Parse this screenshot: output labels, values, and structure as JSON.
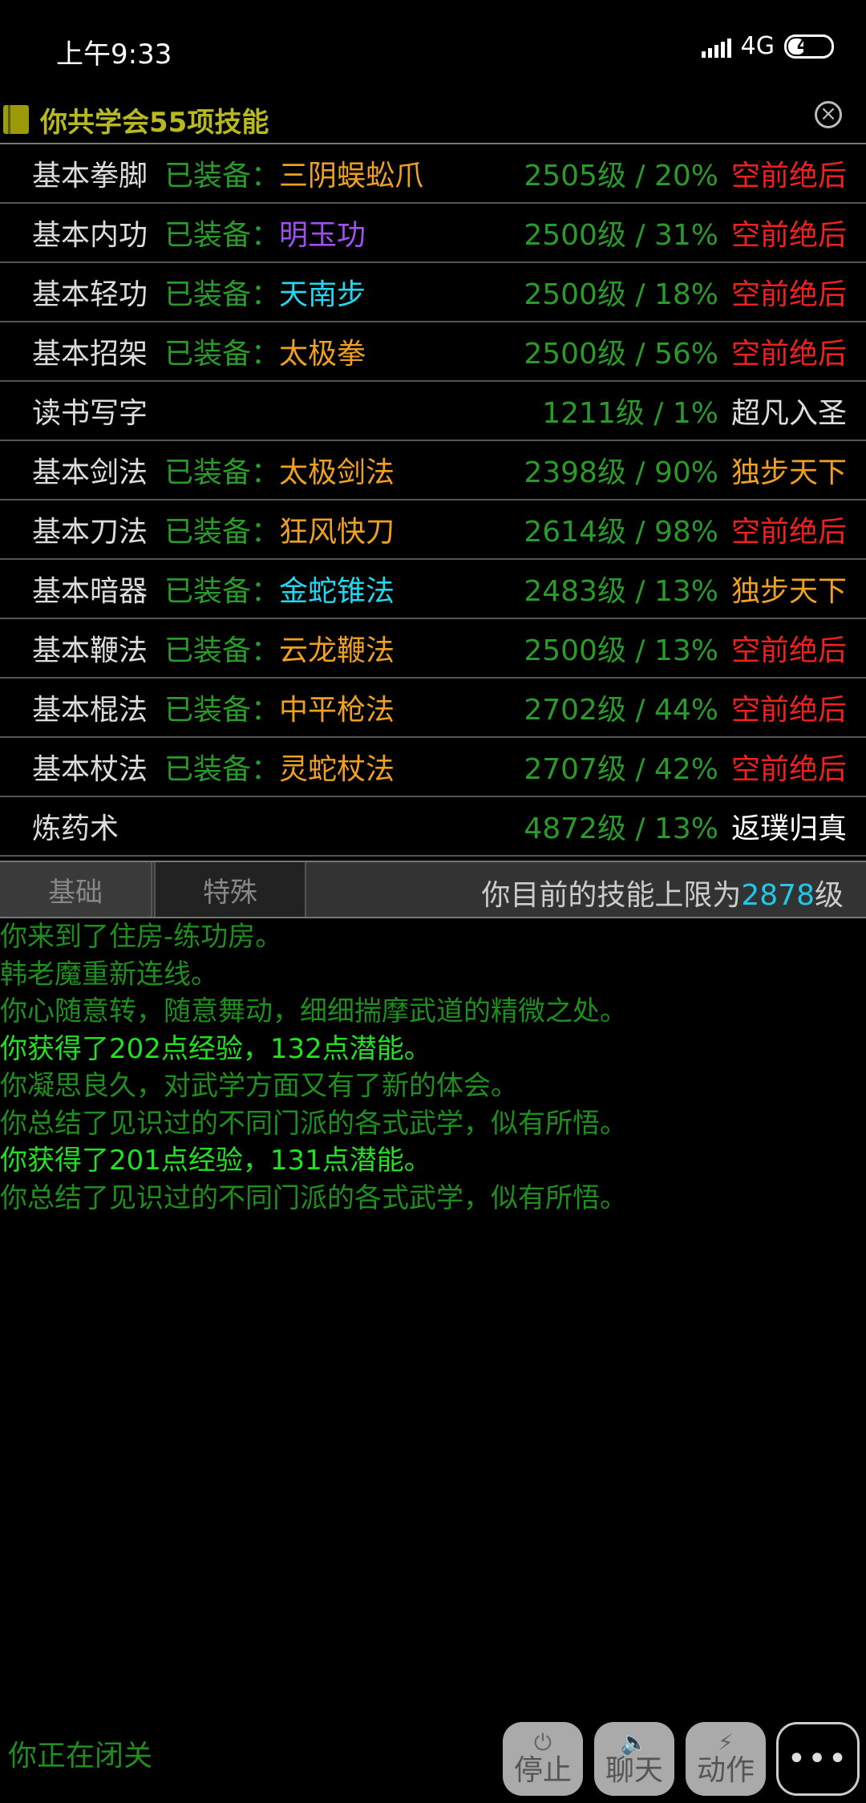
{
  "status_bar": {
    "time": "上午9:33",
    "network": "4G",
    "battery": "41",
    "battery_level": 0.41
  },
  "panel": {
    "title": "你共学会55项技能",
    "close_icon": "close-circle-icon"
  },
  "colors": {
    "green": "#2a9a2a",
    "bright_green": "#22e022",
    "orange": "#f0a020",
    "purple": "#a050f0",
    "cyan": "#22d8f0",
    "red": "#f02020",
    "white": "#ffffff"
  },
  "skills": [
    {
      "name": "基本拳脚",
      "equip_label": "已装备：",
      "equipped": "三阴蜈蚣爪",
      "equipped_color": "#f0a020",
      "level": "2505级 / 20%",
      "rank": "空前绝后",
      "rank_color": "#f02020"
    },
    {
      "name": "基本内功",
      "equip_label": "已装备：",
      "equipped": "明玉功",
      "equipped_color": "#a050f0",
      "level": "2500级 / 31%",
      "rank": "空前绝后",
      "rank_color": "#f02020"
    },
    {
      "name": "基本轻功",
      "equip_label": "已装备：",
      "equipped": "天南步",
      "equipped_color": "#22d8f0",
      "level": "2500级 / 18%",
      "rank": "空前绝后",
      "rank_color": "#f02020"
    },
    {
      "name": "基本招架",
      "equip_label": "已装备：",
      "equipped": "太极拳",
      "equipped_color": "#f0a020",
      "level": "2500级 / 56%",
      "rank": "空前绝后",
      "rank_color": "#f02020"
    },
    {
      "name": "读书写字",
      "equip_label": "",
      "equipped": "",
      "equipped_color": "#f0a020",
      "level": "1211级 / 1%",
      "rank": "超凡入圣",
      "rank_color": "#dddddd"
    },
    {
      "name": "基本剑法",
      "equip_label": "已装备：",
      "equipped": "太极剑法",
      "equipped_color": "#f0a020",
      "level": "2398级 / 90%",
      "rank": "独步天下",
      "rank_color": "#f0a020"
    },
    {
      "name": "基本刀法",
      "equip_label": "已装备：",
      "equipped": "狂风快刀",
      "equipped_color": "#f0a020",
      "level": "2614级 / 98%",
      "rank": "空前绝后",
      "rank_color": "#f02020"
    },
    {
      "name": "基本暗器",
      "equip_label": "已装备：",
      "equipped": "金蛇锥法",
      "equipped_color": "#22d8f0",
      "level": "2483级 / 13%",
      "rank": "独步天下",
      "rank_color": "#f0a020"
    },
    {
      "name": "基本鞭法",
      "equip_label": "已装备：",
      "equipped": "云龙鞭法",
      "equipped_color": "#f0a020",
      "level": "2500级 / 13%",
      "rank": "空前绝后",
      "rank_color": "#f02020"
    },
    {
      "name": "基本棍法",
      "equip_label": "已装备：",
      "equipped": "中平枪法",
      "equipped_color": "#f0a020",
      "level": "2702级 / 44%",
      "rank": "空前绝后",
      "rank_color": "#f02020"
    },
    {
      "name": "基本杖法",
      "equip_label": "已装备：",
      "equipped": "灵蛇杖法",
      "equipped_color": "#f0a020",
      "level": "2707级 / 42%",
      "rank": "空前绝后",
      "rank_color": "#f02020"
    },
    {
      "name": "炼药术",
      "equip_label": "",
      "equipped": "",
      "equipped_color": "#f0a020",
      "level": "4872级 / 13%",
      "rank": "返璞归真",
      "rank_color": "#ffffff"
    }
  ],
  "tabs": {
    "basic": "基础",
    "special": "特殊",
    "limit_prefix": "你目前的技能上限为",
    "limit_value": "2878",
    "limit_suffix": "级"
  },
  "log": [
    {
      "text": "你来到了住房-练功房。",
      "bright": false
    },
    {
      "text": "韩老魔重新连线。",
      "bright": false
    },
    {
      "text": "你心随意转，随意舞动，细细揣摩武道的精微之处。",
      "bright": false
    },
    {
      "text": "你获得了202点经验，132点潜能。",
      "bright": true
    },
    {
      "text": "你凝思良久，对武学方面又有了新的体会。",
      "bright": false
    },
    {
      "text": "你总结了见识过的不同门派的各式武学，似有所悟。",
      "bright": false
    },
    {
      "text": "你获得了201点经验，131点潜能。",
      "bright": true
    },
    {
      "text": "你总结了见识过的不同门派的各式武学，似有所悟。",
      "bright": false
    }
  ],
  "footer": {
    "status": "你正在闭关",
    "stop_label": "停止",
    "stop_icon": "power-icon",
    "chat_label": "聊天",
    "chat_icon": "speaker-icon",
    "action_label": "动作",
    "action_icon": "lightning-icon",
    "more_icon": "more-dots-icon"
  }
}
